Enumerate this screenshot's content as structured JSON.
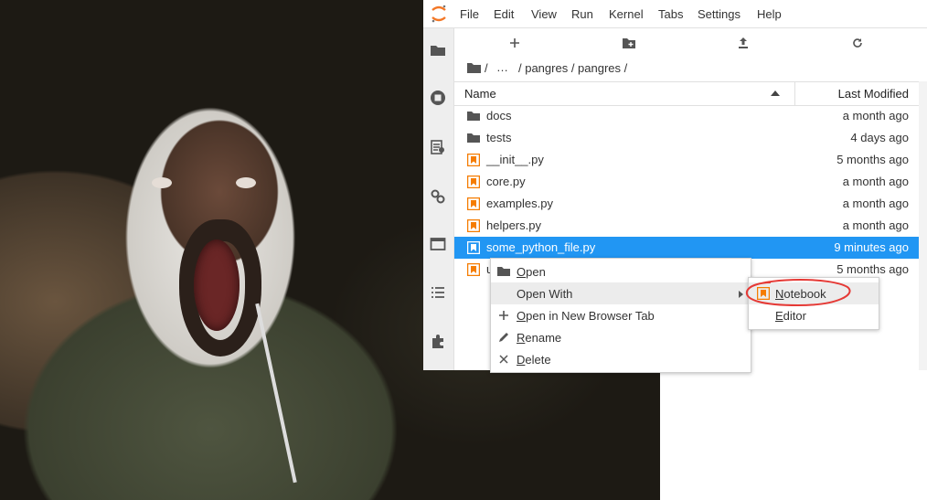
{
  "menubar": {
    "items": [
      "File",
      "Edit",
      "View",
      "Run",
      "Kernel",
      "Tabs",
      "Settings",
      "Help"
    ]
  },
  "sidebar": {
    "icons": [
      "folder-icon",
      "running-icon",
      "commands-icon",
      "property-inspector-icon",
      "tabs-icon",
      "toc-icon",
      "extension-icon"
    ]
  },
  "toolbar": {
    "icons": [
      "new-launcher-icon",
      "new-folder-icon",
      "upload-icon",
      "refresh-icon"
    ]
  },
  "breadcrumbs": {
    "root": "/",
    "ellipsis": "…",
    "path": "/ pangres / pangres /"
  },
  "file_list": {
    "header_name": "Name",
    "header_modified": "Last Modified",
    "rows": [
      {
        "name": "docs",
        "modified": "a month ago",
        "icon": "folder-icon"
      },
      {
        "name": "tests",
        "modified": "4 days ago",
        "icon": "folder-icon"
      },
      {
        "name": "__init__.py",
        "modified": "5 months ago",
        "icon": "python-file-icon"
      },
      {
        "name": "core.py",
        "modified": "a month ago",
        "icon": "python-file-icon"
      },
      {
        "name": "examples.py",
        "modified": "a month ago",
        "icon": "python-file-icon"
      },
      {
        "name": "helpers.py",
        "modified": "a month ago",
        "icon": "python-file-icon"
      },
      {
        "name": "some_python_file.py",
        "modified": "9 minutes ago",
        "icon": "python-file-icon",
        "selected": true
      },
      {
        "name": "u",
        "modified": "5 months ago",
        "icon": "python-file-icon"
      }
    ]
  },
  "context_menu": {
    "items": [
      {
        "label_u": "O",
        "label_rest": "pen",
        "icon": "folder-icon"
      },
      {
        "label_u": "",
        "label_rest": "Open With",
        "icon": "",
        "submenu": true
      },
      {
        "label_u": "O",
        "label_rest": "pen in New Browser Tab",
        "icon": "plus-icon"
      },
      {
        "label_u": "R",
        "label_rest": "ename",
        "icon": "pencil-icon"
      },
      {
        "label_u": "D",
        "label_rest": "elete",
        "icon": "close-icon"
      }
    ]
  },
  "submenu": {
    "items": [
      {
        "label_u": "N",
        "label_rest": "otebook",
        "icon": "notebook-icon"
      },
      {
        "label_u": "E",
        "label_rest": "ditor",
        "icon": ""
      }
    ]
  },
  "colors": {
    "selection": "#2196f3",
    "file_icon": "#f57c00",
    "annotation_circle": "#e53935"
  }
}
